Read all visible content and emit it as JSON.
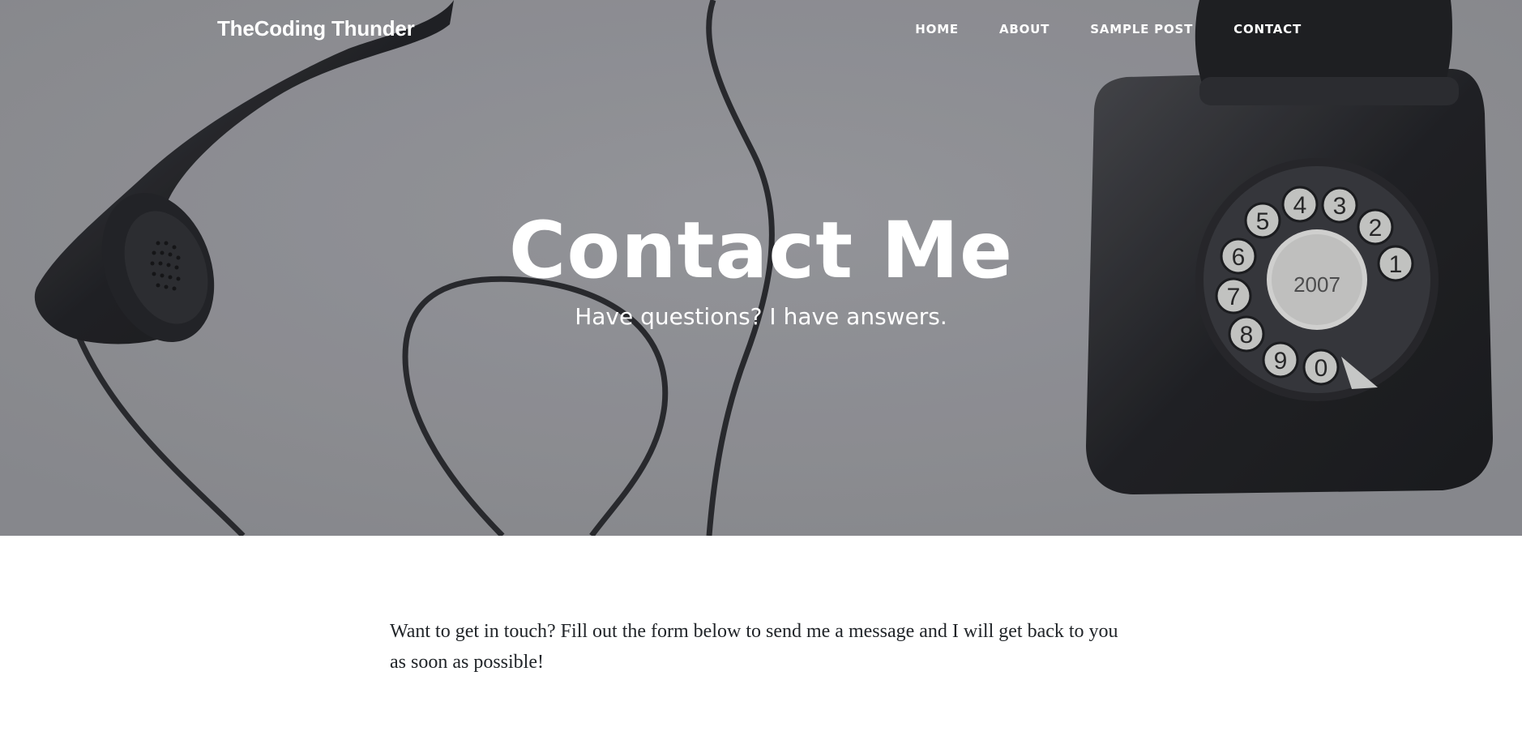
{
  "nav": {
    "brand": "TheCoding Thunder",
    "items": [
      {
        "label": "HOME"
      },
      {
        "label": "ABOUT"
      },
      {
        "label": "SAMPLE POST"
      },
      {
        "label": "CONTACT"
      }
    ]
  },
  "hero": {
    "title": "Contact Me",
    "subtitle": "Have questions? I have answers.",
    "overlay_color": "#8c8d91",
    "dial_numbers": [
      "1",
      "2",
      "3",
      "4",
      "5",
      "6",
      "7",
      "8",
      "9",
      "0"
    ],
    "dial_center_text": "2007"
  },
  "main": {
    "intro": "Want to get in touch? Fill out the form below to send me a message and I will get back to you as soon as possible!"
  }
}
